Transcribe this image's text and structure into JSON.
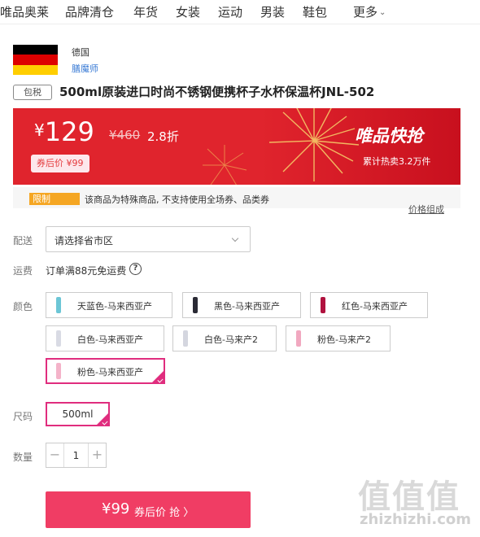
{
  "nav": {
    "items": [
      "唯品奥莱",
      "品牌清仓",
      "年货",
      "女装",
      "运动",
      "男装",
      "鞋包",
      "更多"
    ]
  },
  "origin": {
    "country": "德国",
    "brand": "膳魔师",
    "flag_colors": [
      "#000000",
      "#dd0000",
      "#ffce00"
    ]
  },
  "product": {
    "tax_badge": "包税",
    "title": "500ml原装进口时尚不锈钢便携杯子水杯保温杯JNL-502"
  },
  "price": {
    "currency": "¥",
    "current": "129",
    "original": "¥460",
    "discount": "2.8折",
    "coupon_price": "券后价 ¥99",
    "event_name": "唯品快抢",
    "hot_sold": "累计热卖3.2万件"
  },
  "limit": {
    "tag": "限制",
    "text": "该商品为特殊商品, 不支持使用全场券、品类券",
    "price_structure": "价格组成"
  },
  "delivery": {
    "label": "配送",
    "placeholder": "请选择省市区"
  },
  "shipping": {
    "label": "运费",
    "text": "订单满88元免运费",
    "help_glyph": "?"
  },
  "colors": {
    "label": "颜色",
    "options": [
      {
        "name": "天蓝色-马来西亚产",
        "swatch": "#6cc6d6",
        "selected": false
      },
      {
        "name": "黑色-马来西亚产",
        "swatch": "#2a2a35",
        "selected": false
      },
      {
        "name": "红色-马来西亚产",
        "swatch": "#b0123f",
        "selected": false
      },
      {
        "name": "白色-马来西亚产",
        "swatch": "#d9dbe4",
        "selected": false
      },
      {
        "name": "白色-马来产2",
        "swatch": "#d4d6df",
        "selected": false
      },
      {
        "name": "粉色-马来产2",
        "swatch": "#f1a8c0",
        "selected": false
      },
      {
        "name": "粉色-马来西亚产",
        "swatch": "#f4b3c9",
        "selected": true
      }
    ]
  },
  "size": {
    "label": "尺码",
    "options": [
      {
        "name": "500ml",
        "selected": true
      }
    ]
  },
  "quantity": {
    "label": "数量",
    "value": "1",
    "minus": "−",
    "plus": "+"
  },
  "buy": {
    "price": "¥99",
    "label": "券后价 抢 〉"
  },
  "watermark": {
    "logo": "值值值",
    "url": "zhizhizhi.com"
  },
  "accent_colors": {
    "brand_red": "#e0242d",
    "select_pink": "#e02d7e",
    "buy_button": "#f03d64",
    "limit_tag": "#f5a623"
  }
}
